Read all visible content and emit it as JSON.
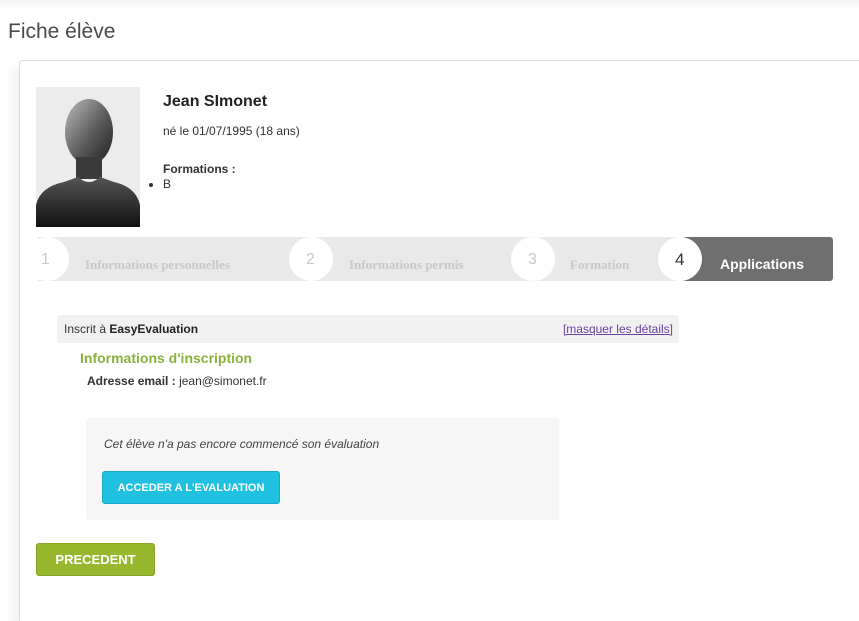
{
  "page": {
    "title": "Fiche élève"
  },
  "student": {
    "name": "Jean SImonet",
    "birth": "né le 01/07/1995 (18 ans)",
    "formations_label": "Formations :",
    "formations": [
      "B"
    ]
  },
  "steps": [
    {
      "number": "1",
      "label": "Informations personnelles",
      "active": false
    },
    {
      "number": "2",
      "label": "Informations permis",
      "active": false
    },
    {
      "number": "3",
      "label": "Formation",
      "active": false
    },
    {
      "number": "4",
      "label": "Applications",
      "active": true
    }
  ],
  "application": {
    "prefix": "Inscrit à",
    "name": "EasyEvaluation",
    "toggle_label": "[masquer les détails]",
    "section_title": "Informations d'inscription",
    "email_label": "Adresse email :",
    "email_value": "jean@simonet.fr",
    "status_text": "Cet élève n'a pas encore commencé son évaluation",
    "access_button": "ACCEDER A L'EVALUATION"
  },
  "nav": {
    "previous_button": "PRECEDENT"
  },
  "colors": {
    "accent_green": "#97b72f",
    "section_green": "#8bb23d",
    "accent_cyan": "#1fc0e0",
    "step_active_bg": "#6f6f6f",
    "step_inactive_bg": "#e9e9e9",
    "link_purple": "#6b3fa0"
  },
  "icons": {
    "avatar": "user-silhouette-icon"
  }
}
